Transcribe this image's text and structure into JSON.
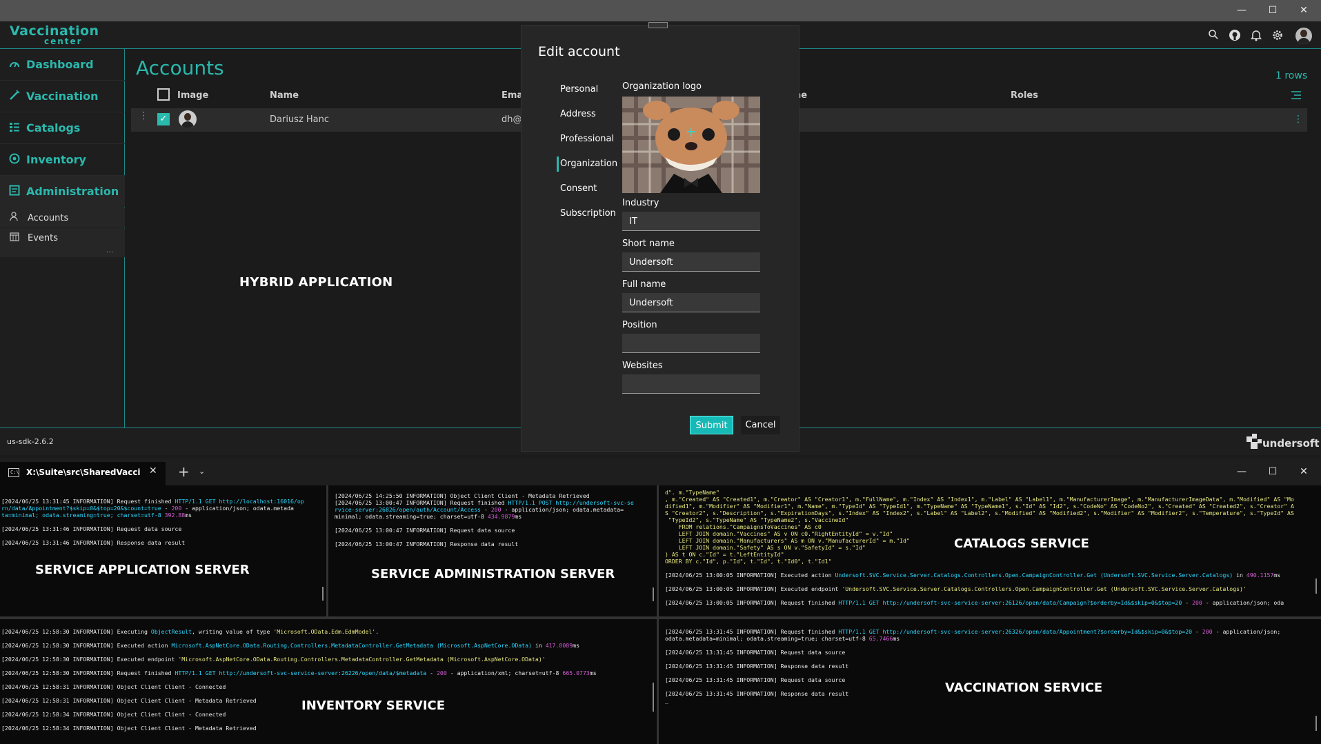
{
  "window": {
    "minimize": "—",
    "maximize": "☐",
    "close": "✕"
  },
  "app": {
    "logo_line1": "Vaccination",
    "logo_line2": "center",
    "version": "us-sdk-2.6.2",
    "brand": "undersoft"
  },
  "sidebar": {
    "items": [
      {
        "label": "Dashboard",
        "icon": "dashboard-icon"
      },
      {
        "label": "Vaccination",
        "icon": "syringe-icon"
      },
      {
        "label": "Catalogs",
        "icon": "catalogs-icon"
      },
      {
        "label": "Inventory",
        "icon": "inventory-icon"
      },
      {
        "label": "Administration",
        "icon": "administration-icon"
      }
    ],
    "subitems": [
      {
        "label": "Accounts"
      },
      {
        "label": "Events"
      }
    ],
    "more": "..."
  },
  "page": {
    "title": "Accounts",
    "rows": "1 rows",
    "overlay_label": "HYBRID APPLICATION"
  },
  "table": {
    "headers": {
      "image": "Image",
      "name": "Name",
      "email": "Emai",
      "phone": "ne",
      "roles": "Roles"
    },
    "rows": [
      {
        "name": "Dariusz Hanc",
        "email": "dh@u"
      }
    ]
  },
  "modal": {
    "title": "Edit account",
    "tabs": [
      "Personal",
      "Address",
      "Professional",
      "Organization",
      "Consent",
      "Subscription"
    ],
    "active_tab": "Organization",
    "logo_label": "Organization logo",
    "fields": [
      {
        "label": "Industry",
        "value": "IT"
      },
      {
        "label": "Short name",
        "value": "Undersoft"
      },
      {
        "label": "Full name",
        "value": "Undersoft"
      },
      {
        "label": "Position",
        "value": ""
      },
      {
        "label": "Websites",
        "value": ""
      }
    ],
    "submit": "Submit",
    "cancel": "Cancel"
  },
  "terminal": {
    "tab_title": "X:\\Suite\\src\\SharedVaccinatior",
    "panes": {
      "app_server": "SERVICE APPLICATION SERVER",
      "admin_server": "SERVICE ADMINISTRATION SERVER",
      "catalogs": "CATALOGS SERVICE",
      "inventory": "INVENTORY SERVICE",
      "vaccination": "VACCINATION SERVICE"
    }
  },
  "colors": {
    "accent": "#2bb8ad",
    "submit": "#17b9b6",
    "terminal_bg": "#0a0a0a"
  }
}
